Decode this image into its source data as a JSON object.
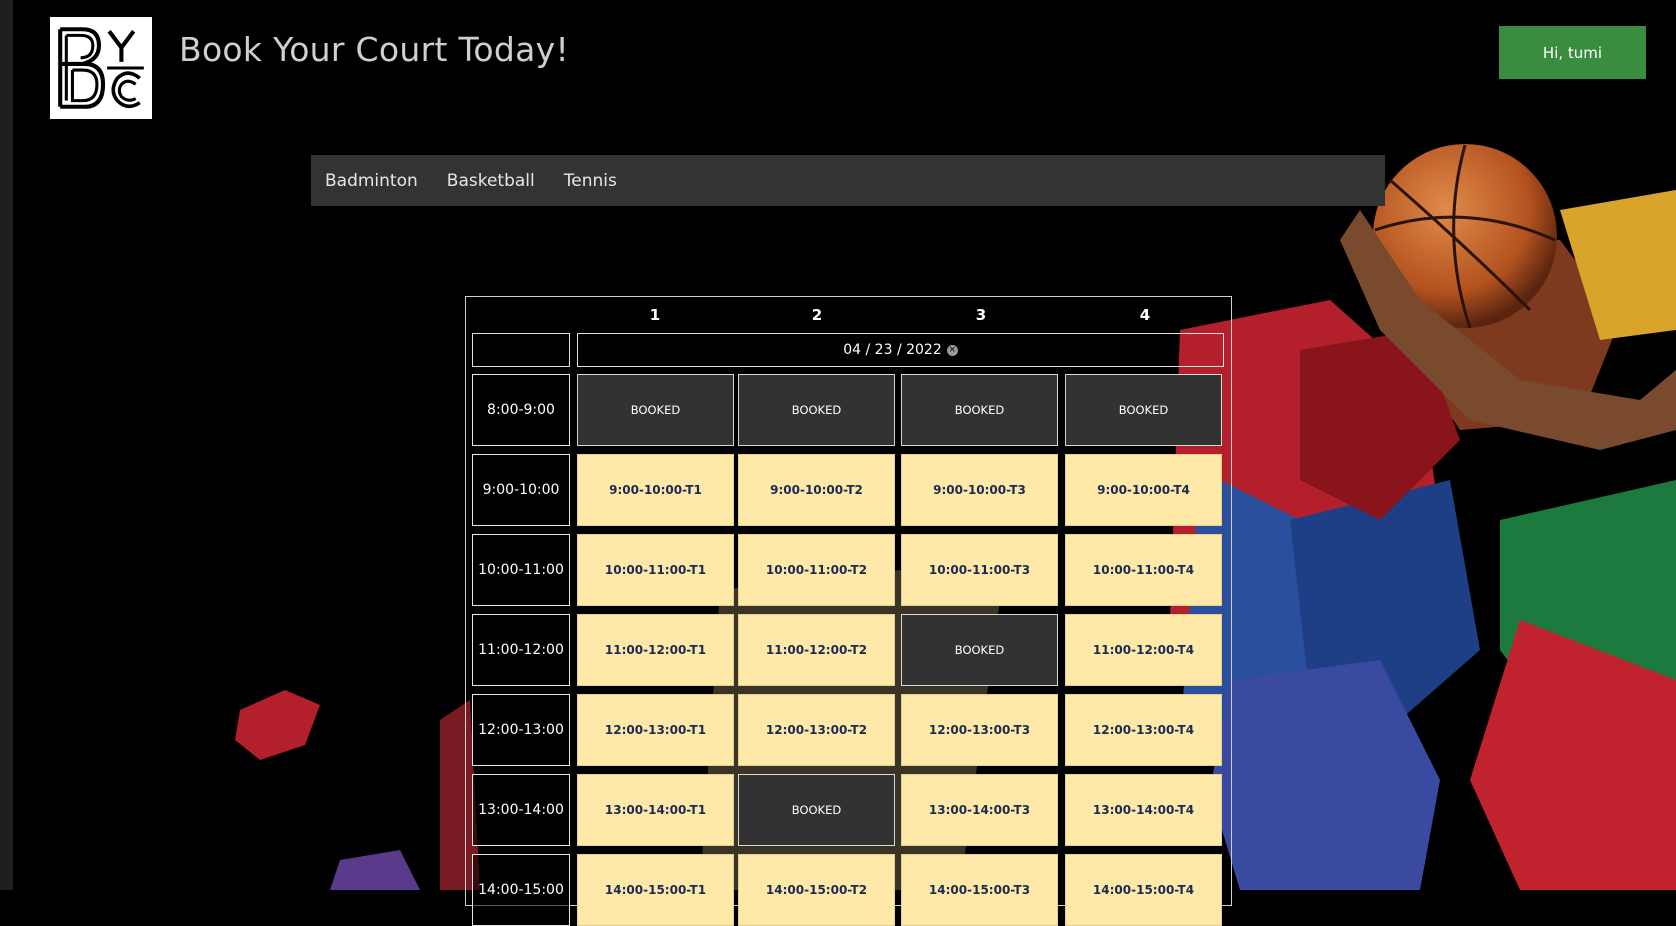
{
  "header": {
    "logo_alt": "BYC",
    "title": "Book Your Court Today!",
    "user_button": "Hi, tumi"
  },
  "nav": {
    "items": [
      "Badminton",
      "Basketball",
      "Tennis"
    ]
  },
  "schedule": {
    "columns": [
      "1",
      "2",
      "3",
      "4"
    ],
    "date": "04 / 23 / 2022",
    "rows": [
      {
        "time": "8:00-9:00",
        "slots": [
          "BOOKED",
          "BOOKED",
          "BOOKED",
          "BOOKED"
        ]
      },
      {
        "time": "9:00-10:00",
        "slots": [
          "9:00-10:00-T1",
          "9:00-10:00-T2",
          "9:00-10:00-T3",
          "9:00-10:00-T4"
        ]
      },
      {
        "time": "10:00-11:00",
        "slots": [
          "10:00-11:00-T1",
          "10:00-11:00-T2",
          "10:00-11:00-T3",
          "10:00-11:00-T4"
        ]
      },
      {
        "time": "11:00-12:00",
        "slots": [
          "11:00-12:00-T1",
          "11:00-12:00-T2",
          "BOOKED",
          "11:00-12:00-T4"
        ]
      },
      {
        "time": "12:00-13:00",
        "slots": [
          "12:00-13:00-T1",
          "12:00-13:00-T2",
          "12:00-13:00-T3",
          "12:00-13:00-T4"
        ]
      },
      {
        "time": "13:00-14:00",
        "slots": [
          "13:00-14:00-T1",
          "BOOKED",
          "13:00-14:00-T3",
          "13:00-14:00-T4"
        ]
      },
      {
        "time": "14:00-15:00",
        "slots": [
          "14:00-15:00-T1",
          "14:00-15:00-T2",
          "14:00-15:00-T3",
          "14:00-15:00-T4"
        ]
      }
    ]
  },
  "colors": {
    "open_slot": "#ffe9a8",
    "booked_slot": "#323232",
    "accent_green": "#3a8c3f",
    "nav_bg": "#333333"
  }
}
